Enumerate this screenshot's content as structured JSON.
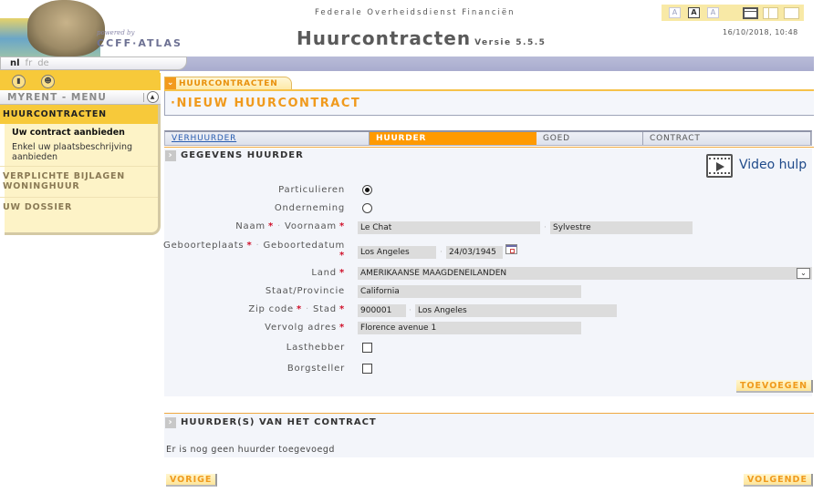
{
  "header": {
    "logo_powered_by": "powered by",
    "logo_name": "CCFF·ATLAS",
    "organization": "Federale Overheidsdienst Financiën",
    "app_title": "Huurcontracten",
    "app_version": "Versie 5.5.5",
    "datetime": "16/10/2018, 10:48",
    "font_size_buttons": [
      "A",
      "A",
      "A"
    ],
    "active_font_size_index": 1,
    "layout_buttons": [
      "layout-header",
      "layout-columns",
      "layout-full"
    ]
  },
  "languages": [
    {
      "code": "nl",
      "active": true
    },
    {
      "code": "fr",
      "active": false
    },
    {
      "code": "de",
      "active": false
    }
  ],
  "sidebar": {
    "icons": [
      "exit-icon",
      "user-profile-icon"
    ],
    "menu_title": "MYRENT - MENU",
    "collapse_icon": "collapse-up-icon",
    "sections": [
      {
        "label": "HUURCONTRACTEN",
        "active": true,
        "items": [
          {
            "label": "Uw contract aanbieden",
            "active": true
          },
          {
            "label": "Enkel uw plaatsbeschrijving aanbieden",
            "active": false
          }
        ]
      },
      {
        "label": "VERPLICHTE BIJLAGEN WONINGHUUR",
        "active": false,
        "items": []
      },
      {
        "label": "UW DOSSIER",
        "active": false,
        "items": []
      }
    ]
  },
  "main": {
    "breadcrumb_tab": "HUURCONTRACTEN",
    "page_title": "·NIEUW HUURCONTRACT",
    "steps": [
      {
        "label": "VERHUURDER",
        "state": "link"
      },
      {
        "label": "HUURDER",
        "state": "active"
      },
      {
        "label": "GOED",
        "state": "inactive"
      },
      {
        "label": "CONTRACT",
        "state": "inactive"
      }
    ],
    "form_section_title": "GEGEVENS HUURDER",
    "video_help_label": "Video hulp",
    "form": {
      "type_particulieren_label": "Particulieren",
      "type_onderneming_label": "Onderneming",
      "selected_type": "Particulieren",
      "naam_label": "Naam",
      "voornaam_label": "Voornaam",
      "naam_value": "Le Chat",
      "voornaam_value": "Sylvestre",
      "geboorteplaats_label": "Geboorteplaats",
      "geboortedatum_label": "Geboortedatum",
      "geboorteplaats_value": "Los Angeles",
      "geboortedatum_value": "24/03/1945",
      "land_label": "Land",
      "land_value": "AMERIKAANSE MAAGDENEILANDEN",
      "staat_label": "Staat/Provincie",
      "staat_value": "California",
      "zip_label": "Zip code",
      "stad_label": "Stad",
      "zip_value": "900001",
      "stad_value": "Los Angeles",
      "adres_label": "Vervolg adres",
      "adres_value": "Florence avenue 1",
      "lasthebber_label": "Lasthebber",
      "lasthebber_checked": false,
      "borgsteller_label": "Borgsteller",
      "borgsteller_checked": false,
      "required_marker": "*",
      "separator": "·"
    },
    "add_button": "TOEVOEGEN",
    "list_section_title": "HUURDER(S) VAN HET CONTRACT",
    "list_empty_message": "Er is nog geen huurder toegevoegd",
    "prev_button": "VORIGE",
    "next_button": "VOLGENDE"
  }
}
